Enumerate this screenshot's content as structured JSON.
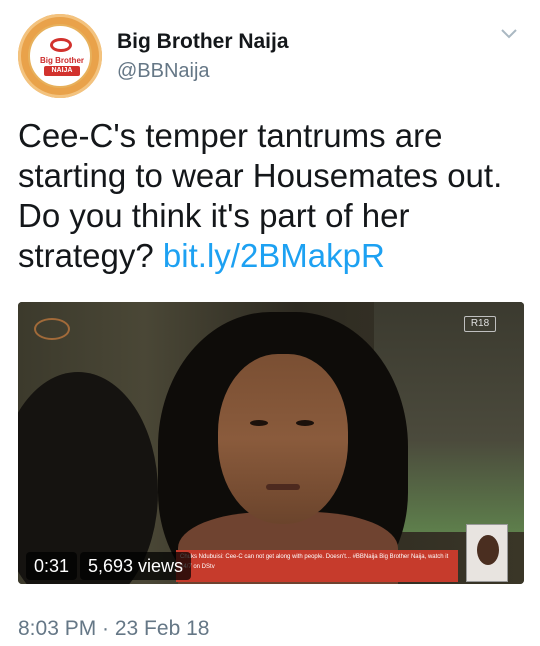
{
  "account": {
    "display_name": "Big Brother Naija",
    "handle": "@BBNaija",
    "avatar_logo_top": "Big Brother",
    "avatar_logo_sub": "NAIJA"
  },
  "tweet": {
    "text": "Cee-C's temper tantrums are starting to wear Housemates out. Do you think it's part of her strategy? ",
    "link": "bit.ly/2BMakpR"
  },
  "media": {
    "duration": "0:31",
    "views": "5,693 views",
    "rating": "R18",
    "ticker": "Chuks Ndubuisi: Cee-C can not get along with people. Doesn't... #BBNaija  Big Brother Naija, watch it 24/7 on DStv"
  },
  "meta": {
    "timestamp": "8:03 PM · 23 Feb 18"
  },
  "icons": {
    "menu": "chevron-down-icon"
  }
}
